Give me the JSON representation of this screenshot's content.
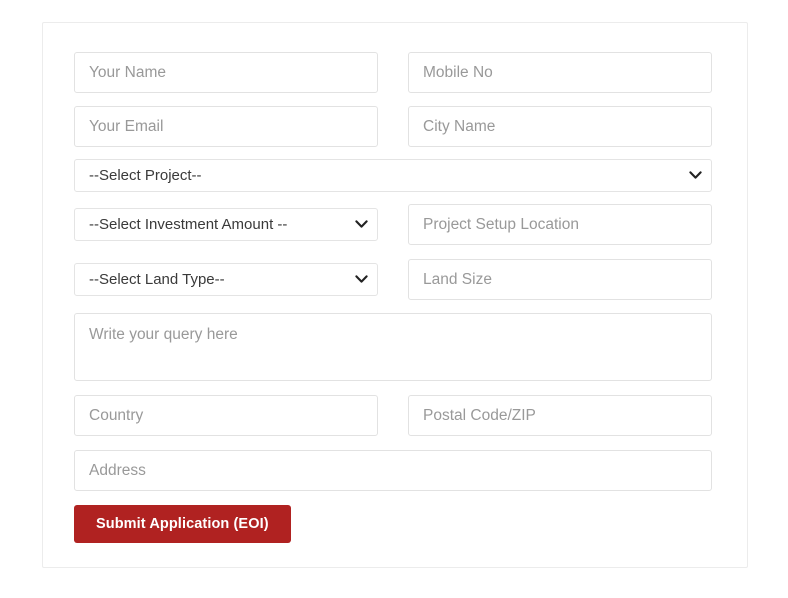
{
  "form": {
    "fields": {
      "name_placeholder": "Your Name",
      "mobile_placeholder": "Mobile No",
      "email_placeholder": "Your Email",
      "city_placeholder": "City Name",
      "location_placeholder": "Project Setup Location",
      "land_size_placeholder": "Land Size",
      "query_placeholder": "Write your query here",
      "country_placeholder": "Country",
      "postal_placeholder": "Postal Code/ZIP",
      "address_placeholder": "Address"
    },
    "values": {
      "name": "",
      "mobile": "",
      "email": "",
      "city": "",
      "location": "",
      "land_size": "",
      "query": "",
      "country": "",
      "postal": "",
      "address": ""
    },
    "selects": {
      "project": {
        "selected": "--Select Project--",
        "options": [
          "--Select Project--"
        ]
      },
      "investment": {
        "selected": "--Select Investment Amount --",
        "options": [
          "--Select Investment Amount --"
        ]
      },
      "land_type": {
        "selected": "--Select Land Type--",
        "options": [
          "--Select Land Type--"
        ]
      }
    },
    "submit_label": "Submit Application (EOI)",
    "colors": {
      "submit_background": "#b02221",
      "submit_text": "#ffffff",
      "field_border": "#e2e2e2",
      "card_border": "#ececec",
      "placeholder_text": "#999999",
      "page_background": "#ffffff"
    },
    "icons": {
      "select_arrow": "chevron-down-icon"
    }
  }
}
